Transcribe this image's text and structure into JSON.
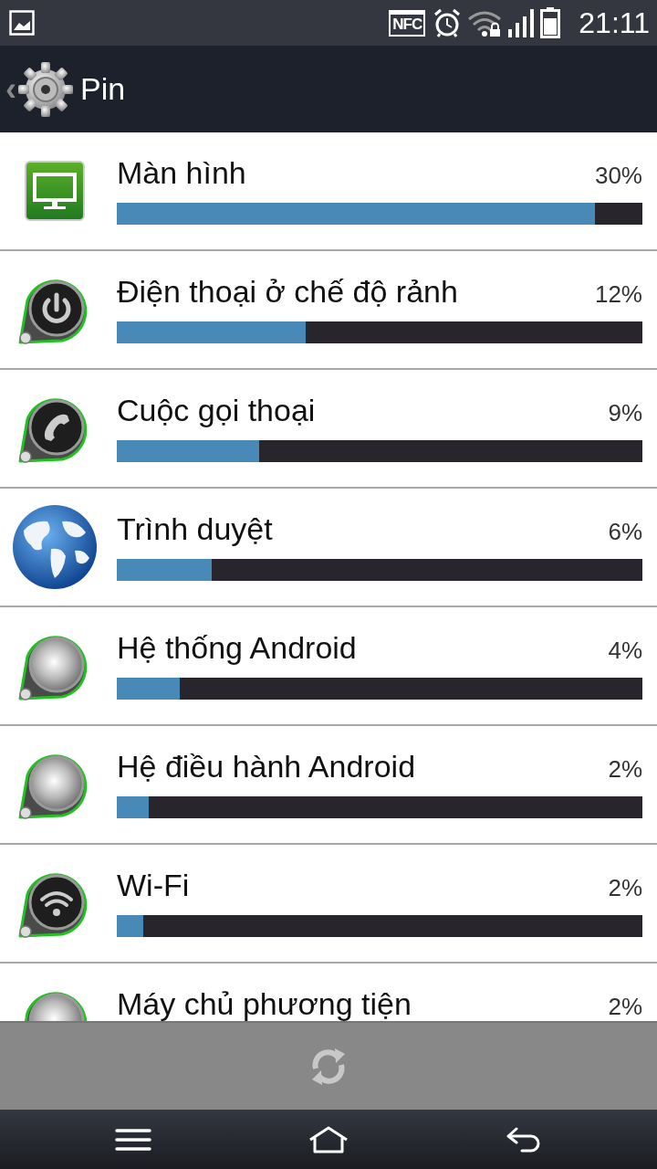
{
  "status_bar": {
    "nfc": "NFC",
    "time": "21:11"
  },
  "action_bar": {
    "back": "‹",
    "title": "Pin"
  },
  "usage": [
    {
      "kind": "monitor",
      "name": "Màn hình",
      "percent": "30%",
      "level": 0.91
    },
    {
      "kind": "power",
      "name": "Điện thoại ở chế  độ rảnh",
      "percent": "12%",
      "level": 0.36
    },
    {
      "kind": "phone",
      "name": "Cuộc gọi thoại",
      "percent": "9%",
      "level": 0.27
    },
    {
      "kind": "globe",
      "name": "Trình duyệt",
      "percent": "6%",
      "level": 0.18
    },
    {
      "kind": "silver",
      "name": "Hệ thống Android",
      "percent": "4%",
      "level": 0.12
    },
    {
      "kind": "silver",
      "name": "Hệ  điều hành Android",
      "percent": "2%",
      "level": 0.06
    },
    {
      "kind": "wifi",
      "name": "Wi-Fi",
      "percent": "2%",
      "level": 0.05
    },
    {
      "kind": "silver",
      "name": "Máy chủ phương tiện",
      "percent": "2%"
    }
  ]
}
